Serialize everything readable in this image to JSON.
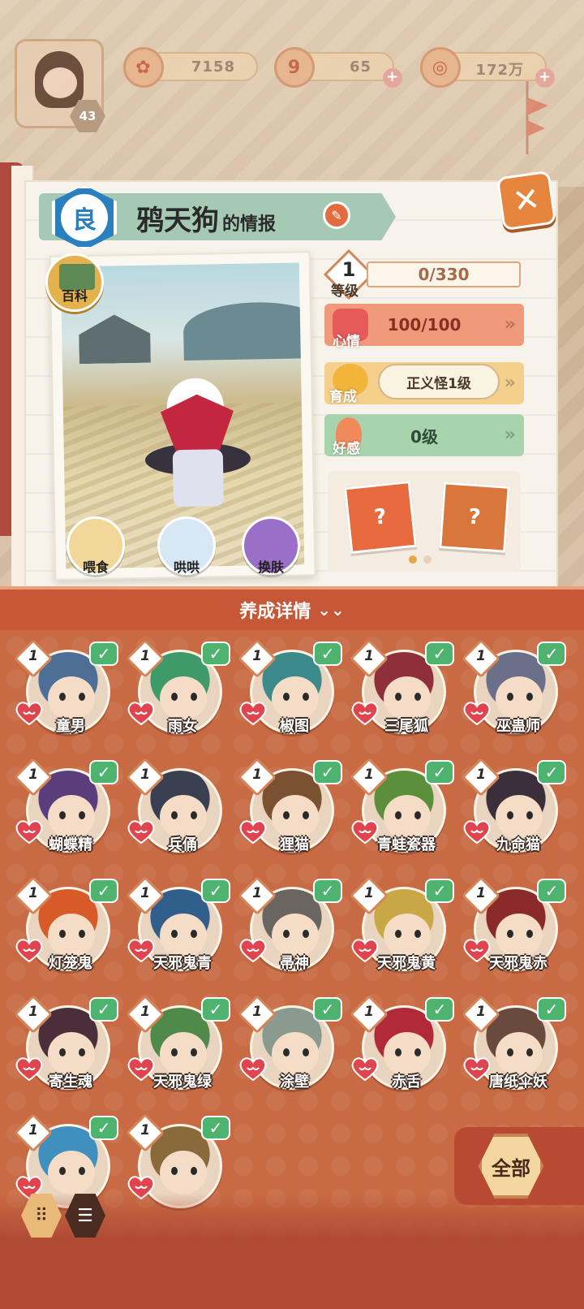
{
  "player": {
    "level": "43"
  },
  "currencies": [
    {
      "id": "flower",
      "value": "7158",
      "icon": "plum-blossom-icon"
    },
    {
      "id": "magatama",
      "value": "65",
      "icon": "magatama-icon"
    },
    {
      "id": "coin",
      "value": "172万",
      "icon": "coin-icon"
    }
  ],
  "info": {
    "rarity": "良",
    "name": "鸦天狗",
    "title_suffix": "的情报",
    "wiki_label": "百科"
  },
  "actions": {
    "feed": "喂食",
    "coax": "哄哄",
    "skin": "换肤"
  },
  "stats": {
    "level": "1",
    "level_label": "等级",
    "exp": "0/330",
    "mood_label": "心情",
    "mood": "100/100",
    "train_label": "育成",
    "train_value": "正义怪1级",
    "fav_label": "好感",
    "fav": "0级"
  },
  "detail_label": "养成详情",
  "all_label": "全部",
  "colors": {
    "accent": "#c65838",
    "check_green": "#4eb36e",
    "rarity_blue": "#2a7fbf"
  },
  "characters": [
    {
      "name": "童男",
      "level": "1",
      "color": "#4d6f96",
      "checked": true
    },
    {
      "name": "雨女",
      "level": "1",
      "color": "#3f9a6a",
      "checked": true
    },
    {
      "name": "椒图",
      "level": "1",
      "color": "#3d8a8c",
      "checked": true
    },
    {
      "name": "三尾狐",
      "level": "1",
      "color": "#8f2f3a",
      "checked": true
    },
    {
      "name": "巫蛊师",
      "level": "1",
      "color": "#6a6f8a",
      "checked": true
    },
    {
      "name": "蝴蝶精",
      "level": "1",
      "color": "#5a3d7a",
      "checked": true
    },
    {
      "name": "兵俑",
      "level": "1",
      "color": "#3b3f52",
      "checked": false
    },
    {
      "name": "狸猫",
      "level": "1",
      "color": "#7a5232",
      "checked": true
    },
    {
      "name": "青蛙瓷器",
      "level": "1",
      "color": "#5c8f3c",
      "checked": true
    },
    {
      "name": "九命猫",
      "level": "1",
      "color": "#3a2f3a",
      "checked": true
    },
    {
      "name": "灯笼鬼",
      "level": "1",
      "color": "#d85a28",
      "checked": true
    },
    {
      "name": "天邪鬼青",
      "level": "1",
      "color": "#2f5f8a",
      "checked": true
    },
    {
      "name": "帚神",
      "level": "1",
      "color": "#6a6560",
      "checked": true
    },
    {
      "name": "天邪鬼黄",
      "level": "1",
      "color": "#c9a646",
      "checked": true
    },
    {
      "name": "天邪鬼赤",
      "level": "1",
      "color": "#8a2a2a",
      "checked": true
    },
    {
      "name": "寄生魂",
      "level": "1",
      "color": "#4a2f3a",
      "checked": true
    },
    {
      "name": "天邪鬼绿",
      "level": "1",
      "color": "#4f8a4a",
      "checked": true
    },
    {
      "name": "涂壁",
      "level": "1",
      "color": "#8a9a8f",
      "checked": true
    },
    {
      "name": "赤舌",
      "level": "1",
      "color": "#b02a3a",
      "checked": true
    },
    {
      "name": "唐纸伞妖",
      "level": "1",
      "color": "#6a4a3f",
      "checked": true
    },
    {
      "name": "",
      "level": "1",
      "color": "#3f8fbf",
      "checked": true
    },
    {
      "name": "",
      "level": "1",
      "color": "#8a6a3a",
      "checked": true
    }
  ]
}
